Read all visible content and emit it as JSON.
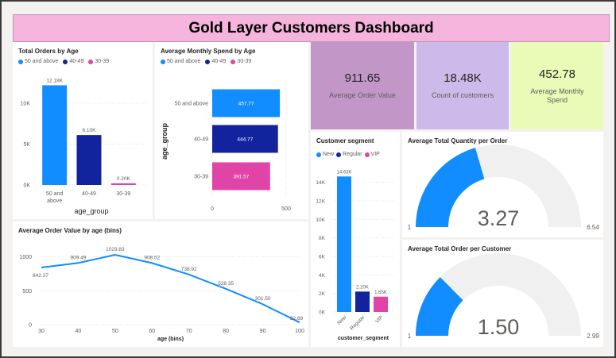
{
  "dashboard": {
    "title": "Gold Layer Customers Dashboard"
  },
  "colors": {
    "blue": "#118dff",
    "navy": "#12239e",
    "pink": "#e044a7",
    "gray": "#f0f0f0"
  },
  "kpis": [
    {
      "value": "911.65",
      "label": "Average Order Value",
      "bg": "#c297c8"
    },
    {
      "value": "18.48K",
      "label": "Count of customers",
      "bg": "#cdb9ea"
    },
    {
      "value": "452.78",
      "label": "Average Monthly Spend",
      "bg": "#e9fbb6"
    }
  ],
  "chart_data": [
    {
      "type": "bar",
      "title": "Total Orders by Age",
      "xlabel": "age_group",
      "ylabel": "",
      "categories": [
        "50 and above",
        "40-49",
        "30-39"
      ],
      "values": [
        12180,
        6100,
        200
      ],
      "data_labels": [
        "12.18K",
        "6.10K",
        "0.20K"
      ],
      "legend": [
        "50 and above",
        "40-49",
        "30-39"
      ],
      "ylim": [
        0,
        13000
      ],
      "yticks": [
        0,
        5000,
        10000
      ],
      "ytick_labels": [
        "0K",
        "5K",
        "10K"
      ]
    },
    {
      "type": "bar",
      "orientation": "horizontal",
      "title": "Average Monthly Spend by Age",
      "xlabel": "",
      "ylabel": "age_group",
      "categories": [
        "50 and above",
        "40-49",
        "30-39"
      ],
      "values": [
        457.77,
        444.77,
        391.57
      ],
      "data_labels": [
        "457.77",
        "444.77",
        "391.57"
      ],
      "legend": [
        "50 and above",
        "40-49",
        "30-39"
      ],
      "xlim": [
        0,
        500
      ],
      "xticks": [
        0,
        500
      ]
    },
    {
      "type": "line",
      "title": "Average Order Value by age (bins)",
      "xlabel": "age (bins)",
      "ylabel": "",
      "x": [
        30,
        40,
        50,
        60,
        70,
        80,
        90,
        100
      ],
      "values": [
        842.37,
        909.49,
        1029.83,
        908.52,
        738.92,
        528.35,
        301.5,
        32.89
      ],
      "data_labels": [
        "842.37",
        "909.49",
        "1029.83",
        "908.52",
        "738.92",
        "528.35",
        "301.50",
        "32.89"
      ],
      "xlim": [
        30,
        100
      ],
      "ylim": [
        0,
        1100
      ],
      "yticks": [
        0,
        500,
        1000
      ],
      "xticks": [
        30,
        40,
        50,
        60,
        70,
        80,
        90,
        100
      ]
    },
    {
      "type": "bar",
      "title": "Customer segment",
      "xlabel": "customer_segment",
      "ylabel": "",
      "categories": [
        "New",
        "Regular",
        "VIP"
      ],
      "values": [
        14630,
        2200,
        1650
      ],
      "data_labels": [
        "14.63K",
        "2.20K",
        "1.65K"
      ],
      "legend": [
        "New",
        "Regular",
        "VIP"
      ],
      "ylim": [
        0,
        15000
      ],
      "yticks": [
        0,
        2000,
        4000,
        6000,
        8000,
        10000,
        12000,
        14000
      ],
      "ytick_labels": [
        "0K",
        "2K",
        "4K",
        "6K",
        "8K",
        "10K",
        "12K",
        "14K"
      ]
    },
    {
      "type": "gauge",
      "title": "Average Total Quantity per Order",
      "value": 3.27,
      "value_label": "3.27",
      "min": 1,
      "max": 6.54,
      "min_label": "1",
      "max_label": "6.54"
    },
    {
      "type": "gauge",
      "title": "Average Total Order per Customer",
      "value": 1.5,
      "value_label": "1.50",
      "min": 1,
      "max": 2.99,
      "min_label": "1",
      "max_label": "2.99"
    }
  ]
}
